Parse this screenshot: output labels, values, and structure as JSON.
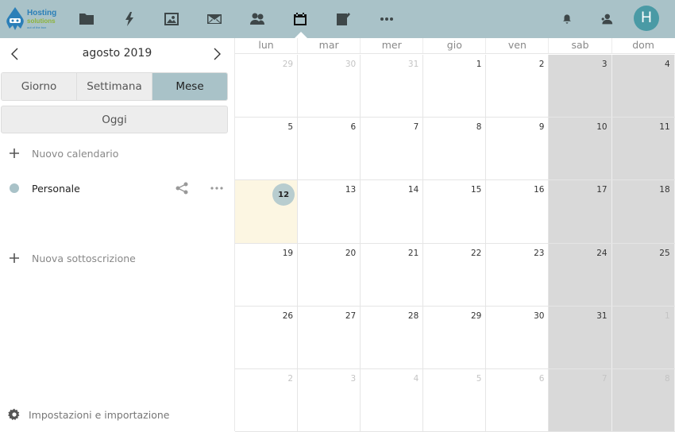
{
  "topbar": {
    "logo": {
      "line1": "Hosting",
      "line2": "solutions",
      "line3": "out of the box"
    },
    "apps": [
      {
        "name": "files",
        "icon": "folder-icon"
      },
      {
        "name": "activity",
        "icon": "lightning-icon"
      },
      {
        "name": "gallery",
        "icon": "image-icon"
      },
      {
        "name": "mail",
        "icon": "mail-icon"
      },
      {
        "name": "contacts",
        "icon": "contacts-icon"
      },
      {
        "name": "calendar",
        "icon": "calendar-icon",
        "active": true
      },
      {
        "name": "notes",
        "icon": "notes-icon"
      },
      {
        "name": "more",
        "icon": "more-icon"
      }
    ],
    "avatar_letter": "H"
  },
  "sidebar": {
    "month_title": "agosto 2019",
    "prev_arrow": "‹",
    "next_arrow": "›",
    "views": [
      "Giorno",
      "Settimana",
      "Mese"
    ],
    "active_view": "Mese",
    "today_label": "Oggi",
    "new_calendar_label": "Nuovo calendario",
    "calendars": [
      {
        "name": "Personale",
        "color": "#a9c2c8"
      }
    ],
    "new_subscription_label": "Nuova sottoscrizione",
    "settings_label": "Impostazioni e importazione"
  },
  "calendar": {
    "weekdays": [
      "lun",
      "mar",
      "mer",
      "gio",
      "ven",
      "sab",
      "dom"
    ],
    "today": 12,
    "weeks": [
      [
        {
          "d": "29",
          "o": true
        },
        {
          "d": "30",
          "o": true
        },
        {
          "d": "31",
          "o": true
        },
        {
          "d": "1"
        },
        {
          "d": "2"
        },
        {
          "d": "3"
        },
        {
          "d": "4"
        }
      ],
      [
        {
          "d": "5"
        },
        {
          "d": "6"
        },
        {
          "d": "7"
        },
        {
          "d": "8"
        },
        {
          "d": "9"
        },
        {
          "d": "10"
        },
        {
          "d": "11"
        }
      ],
      [
        {
          "d": "12",
          "t": true
        },
        {
          "d": "13"
        },
        {
          "d": "14"
        },
        {
          "d": "15"
        },
        {
          "d": "16"
        },
        {
          "d": "17"
        },
        {
          "d": "18"
        }
      ],
      [
        {
          "d": "19"
        },
        {
          "d": "20"
        },
        {
          "d": "21"
        },
        {
          "d": "22"
        },
        {
          "d": "23"
        },
        {
          "d": "24"
        },
        {
          "d": "25"
        }
      ],
      [
        {
          "d": "26"
        },
        {
          "d": "27"
        },
        {
          "d": "28"
        },
        {
          "d": "29"
        },
        {
          "d": "30"
        },
        {
          "d": "31"
        },
        {
          "d": "1",
          "o": true
        }
      ],
      [
        {
          "d": "2",
          "o": true
        },
        {
          "d": "3",
          "o": true
        },
        {
          "d": "4",
          "o": true
        },
        {
          "d": "5",
          "o": true
        },
        {
          "d": "6",
          "o": true
        },
        {
          "d": "7",
          "o": true
        },
        {
          "d": "8",
          "o": true
        }
      ]
    ]
  }
}
